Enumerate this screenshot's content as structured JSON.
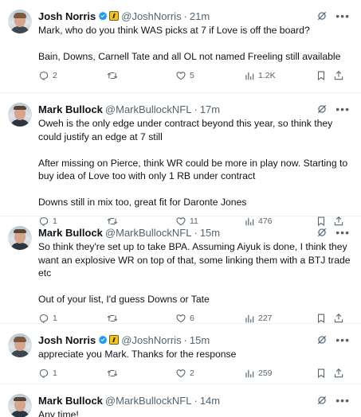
{
  "tweets": [
    {
      "name": "Josh Norris",
      "verified": true,
      "badge": true,
      "handle": "@JoshNorris",
      "time": "21m",
      "text": "Mark, who do you think WAS picks at 7 if Love is off the board?\n\nBain, Downs, Carnell Tate and all OL not named Freeling still available",
      "replies": "2",
      "retweets": "",
      "likes": "5",
      "views": "1.2K"
    },
    {
      "name": "Mark Bullock",
      "verified": false,
      "badge": false,
      "handle": "@MarkBullockNFL",
      "time": "17m",
      "text": "Oweh is the only edge under contract beyond this year, so think they could justify an edge at 7 still\n\nAfter missing on Pierce, think WR could be more in play now. Starting to buy idea of Love too with only 1 RB under contract\n\nDowns still in mix too, great fit for Daronte Jones",
      "replies": "1",
      "retweets": "",
      "likes": "11",
      "views": "476"
    },
    {
      "name": "Mark Bullock",
      "verified": false,
      "badge": false,
      "handle": "@MarkBullockNFL",
      "time": "15m",
      "text": "So think they're set up to take BPA. Assuming Aiyuk is done, I think they want an explosive WR on top of that, some linking them with a BTJ trade etc\n\nOut of your list, I'd guess Downs or Tate",
      "replies": "1",
      "retweets": "",
      "likes": "6",
      "views": "227"
    },
    {
      "name": "Josh Norris",
      "verified": true,
      "badge": true,
      "handle": "@JoshNorris",
      "time": "15m",
      "text": "appreciate you Mark. Thanks for the response",
      "replies": "1",
      "retweets": "",
      "likes": "2",
      "views": "259"
    },
    {
      "name": "Mark Bullock",
      "verified": false,
      "badge": false,
      "handle": "@MarkBullockNFL",
      "time": "14m",
      "text": "Any time!",
      "replies": "",
      "retweets": "",
      "likes": "",
      "views": ""
    }
  ],
  "separator": "·",
  "colors": {
    "text": "#0f1419",
    "secondary": "#536471",
    "verified": "#1d9bf0",
    "thread_line": "#cfd9de"
  },
  "icons": [
    "reply-icon",
    "retweet-icon",
    "like-icon",
    "views-icon",
    "bookmark-icon",
    "share-icon",
    "grok-icon",
    "more-icon",
    "verified-icon"
  ]
}
